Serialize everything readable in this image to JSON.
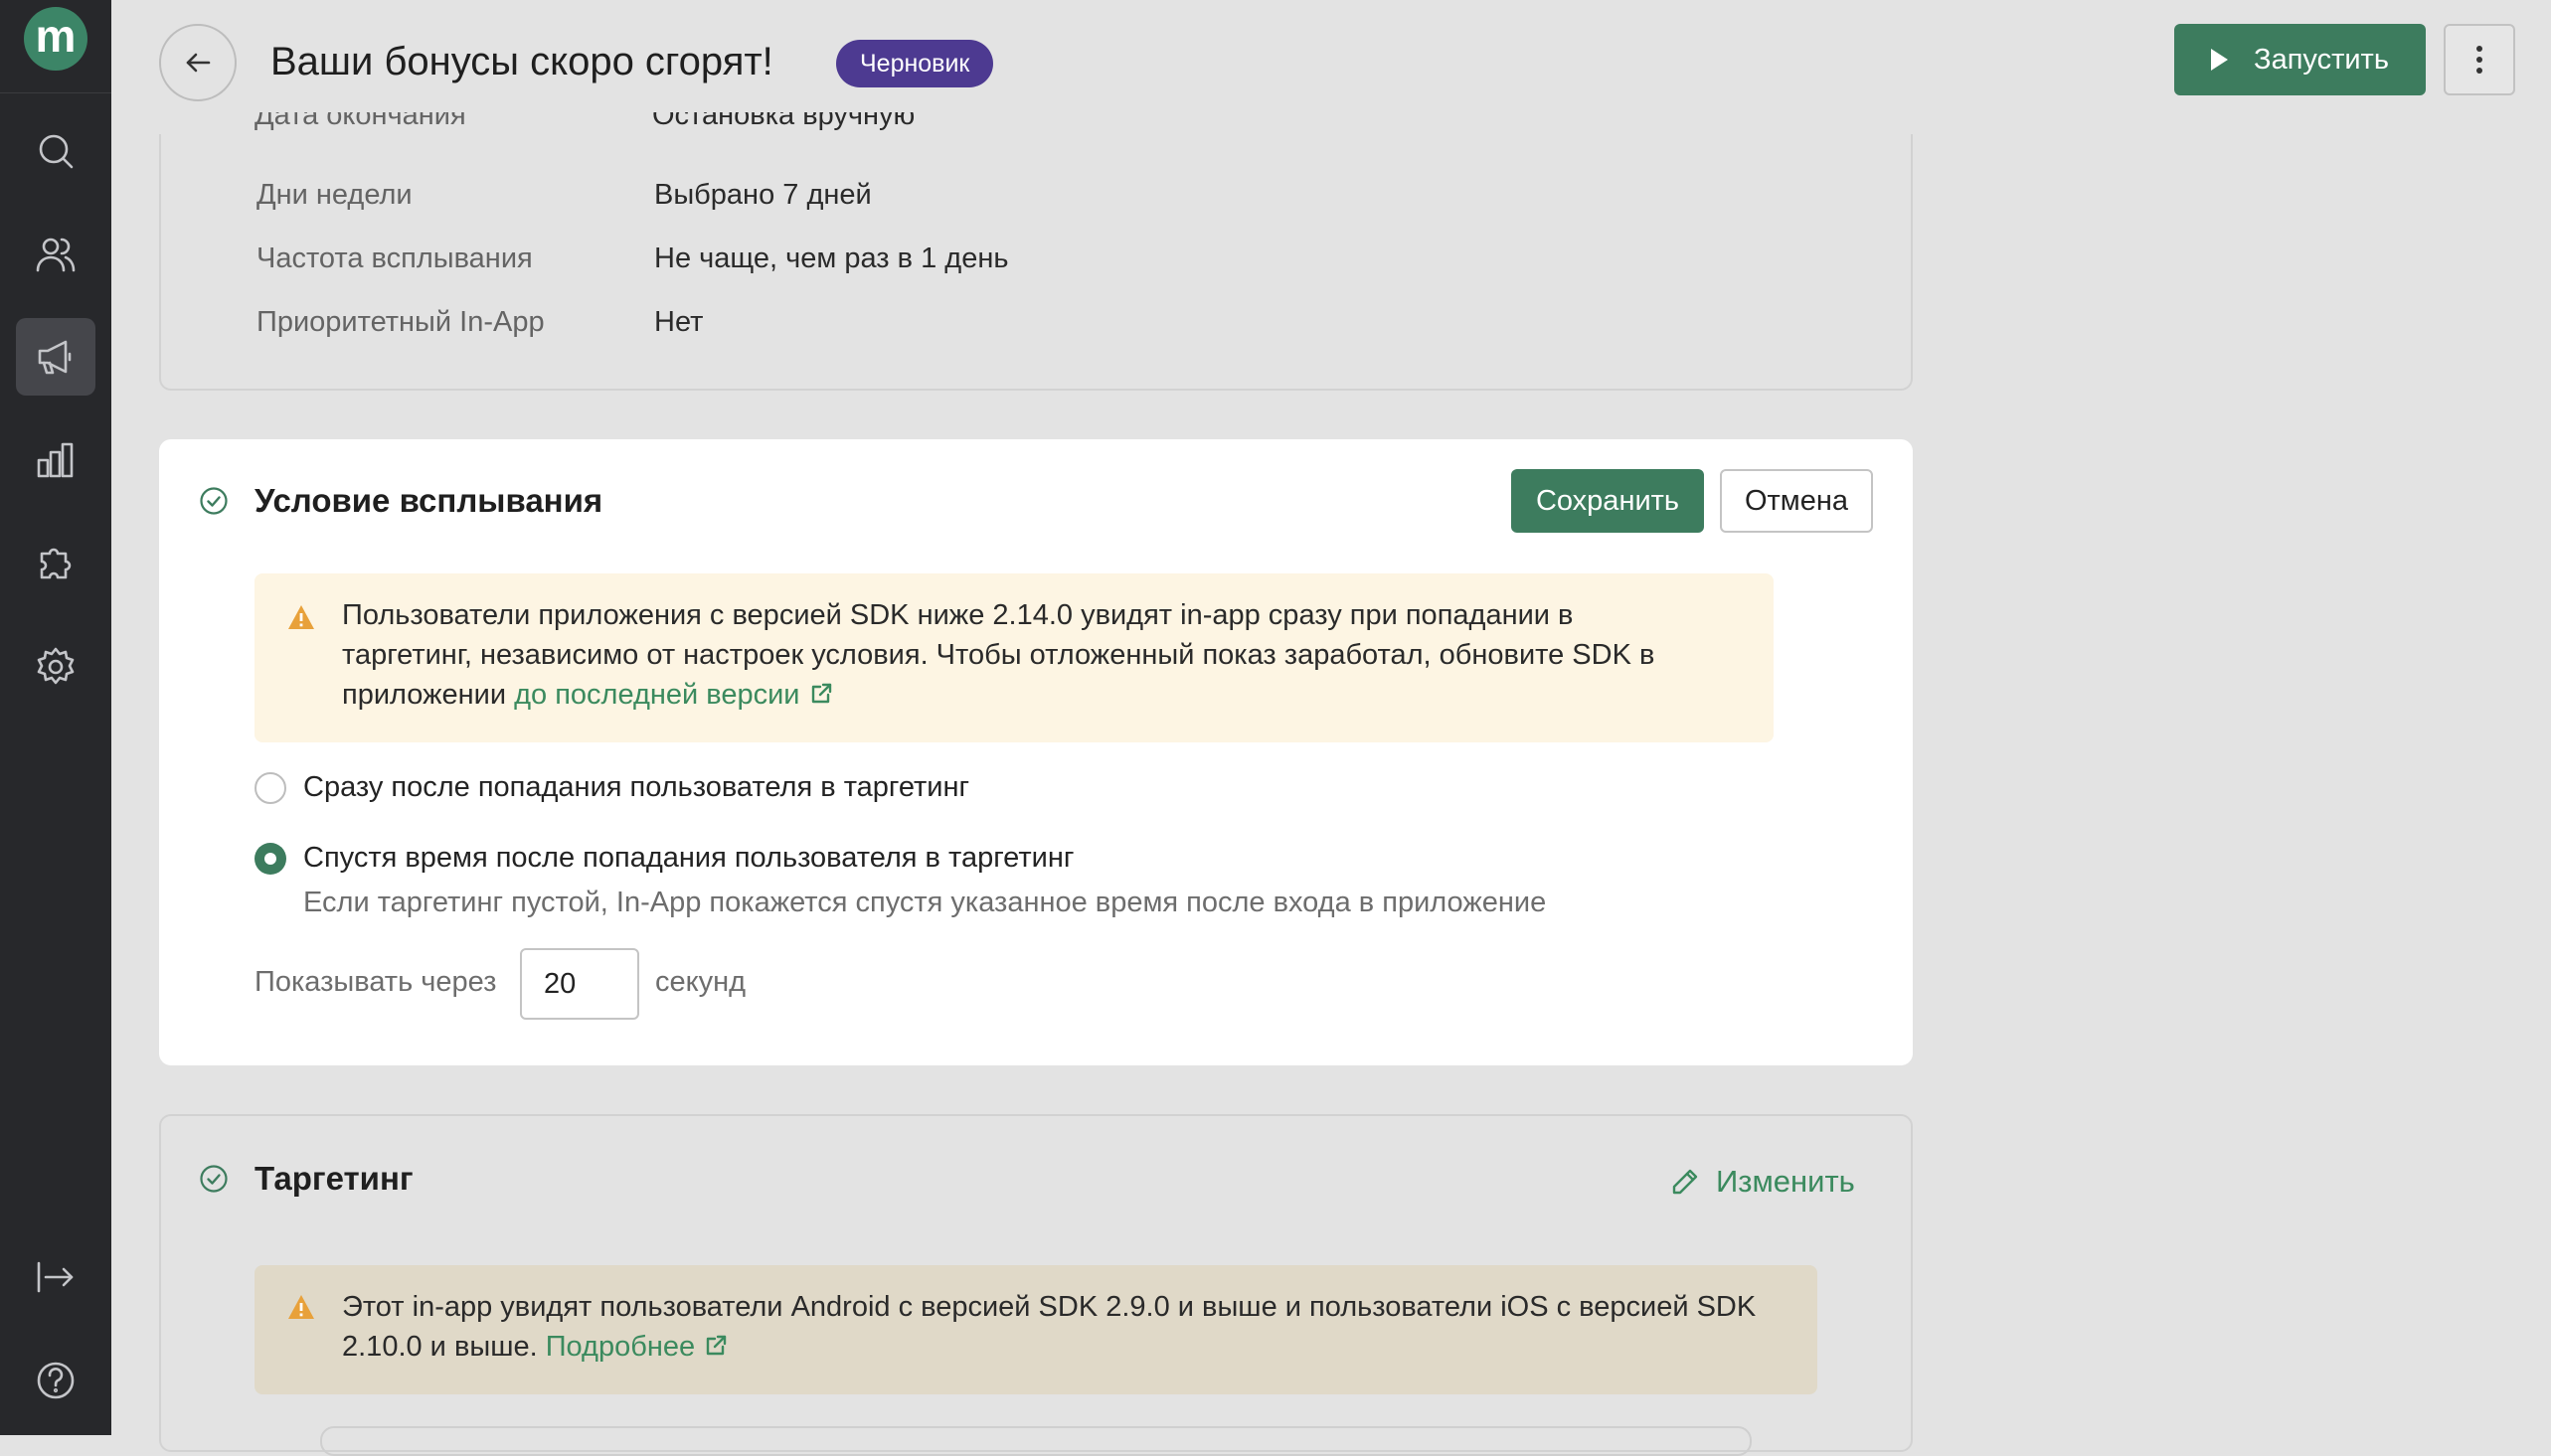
{
  "app": {
    "logo_letter": "m"
  },
  "sidebar": {
    "items": [
      {
        "icon": "search-icon"
      },
      {
        "icon": "users-icon"
      },
      {
        "icon": "megaphone-icon",
        "active": true
      },
      {
        "icon": "chart-icon"
      },
      {
        "icon": "puzzle-icon"
      },
      {
        "icon": "gear-icon"
      }
    ],
    "bottom": [
      {
        "icon": "logout-icon"
      },
      {
        "icon": "help-icon"
      }
    ]
  },
  "header": {
    "title": "Ваши бонусы скоро сгорят!",
    "status": "Черновик",
    "launch_label": "Запустить"
  },
  "summary": {
    "partial_row": {
      "label": "Дата окончания",
      "value": "Остановка вручную"
    },
    "rows": [
      {
        "label": "Дни недели",
        "value": "Выбрано 7 дней"
      },
      {
        "label": "Частота всплывания",
        "value": "Не чаще, чем раз в 1 день"
      },
      {
        "label": "Приоритетный In-App",
        "value": "Нет"
      }
    ]
  },
  "trigger": {
    "title": "Условие всплывания",
    "save_label": "Сохранить",
    "cancel_label": "Отмена",
    "warning": {
      "line1": "Пользователи приложения с версией SDK ниже 2.14.0 увидят in-app сразу при попадании в",
      "line2": "таргетинг, независимо от настроек условия. Чтобы отложенный показ заработал, обновите SDK в",
      "line3_text": "приложении ",
      "line3_link": "до последней версии"
    },
    "option_immediate": "Сразу после попадания пользователя в таргетинг",
    "option_delayed": "Спустя время после попадания пользователя в таргетинг",
    "option_delayed_hint": "Если таргетинг пустой, In-App покажется спустя указанное время после входа в приложение",
    "selected": "delayed",
    "delay_prefix": "Показывать через",
    "delay_value": "20",
    "delay_unit": "секунд"
  },
  "targeting": {
    "title": "Таргетинг",
    "edit_label": "Изменить",
    "warning": {
      "line1": "Этот in-app увидят пользователи Android с версией SDK 2.9.0 и выше и пользователи iOS с версией SDK",
      "line2_text": "2.10.0 и выше. ",
      "line2_link": "Подробнее"
    }
  },
  "colors": {
    "accent_green": "#3d7c5e",
    "link_green": "#3b8a5e",
    "badge_purple": "#4d3a91",
    "warning_bg": "#fdf5e3",
    "warning_icon": "#e8a13a",
    "sidebar_bg": "#27282b"
  }
}
